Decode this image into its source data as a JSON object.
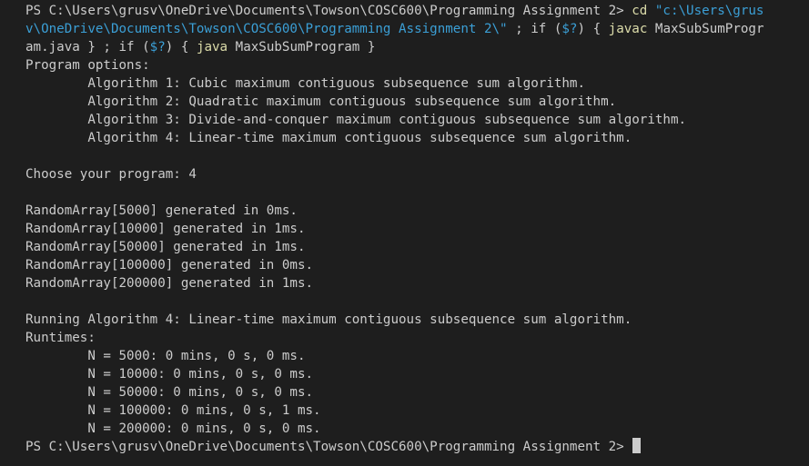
{
  "terminal": {
    "prompt": "PS C:\\Users\\grusv\\OneDrive\\Documents\\Towson\\COSC600\\Programming Assignment 2> ",
    "command": {
      "cd": "cd",
      "path_part1": "\"c:\\Users\\grus",
      "path_part2": "v\\OneDrive\\Documents\\Towson\\COSC600\\Programming Assignment 2\\\"",
      "sep1": " ; if (",
      "var1": "$?",
      "sep2": ") { ",
      "javac": "javac",
      "file_part1": " MaxSubSumProgr",
      "file_part2": "am.java",
      "sep3": " } ; if (",
      "var2": "$?",
      "sep4": ") { ",
      "java": "java",
      "class": " MaxSubSumProgram",
      "end": " }"
    },
    "output": [
      "Program options:",
      "        Algorithm 1: Cubic maximum contiguous subsequence sum algorithm.",
      "        Algorithm 2: Quadratic maximum contiguous subsequence sum algorithm.",
      "        Algorithm 3: Divide-and-conquer maximum contiguous subsequence sum algorithm.",
      "        Algorithm 4: Linear-time maximum contiguous subsequence sum algorithm.",
      "",
      "Choose your program: 4",
      "",
      "RandomArray[5000] generated in 0ms.",
      "RandomArray[10000] generated in 1ms.",
      "RandomArray[50000] generated in 1ms.",
      "RandomArray[100000] generated in 0ms.",
      "RandomArray[200000] generated in 1ms.",
      "",
      "Running Algorithm 4: Linear-time maximum contiguous subsequence sum algorithm.",
      "Runtimes:",
      "        N = 5000: 0 mins, 0 s, 0 ms.",
      "        N = 10000: 0 mins, 0 s, 0 ms.",
      "        N = 50000: 0 mins, 0 s, 0 ms.",
      "        N = 100000: 0 mins, 0 s, 1 ms.",
      "        N = 200000: 0 mins, 0 s, 0 ms."
    ],
    "final_prompt": "PS C:\\Users\\grusv\\OneDrive\\Documents\\Towson\\COSC600\\Programming Assignment 2> ",
    "colors": {
      "background": "#1e1e1e",
      "text": "#cccccc",
      "command_yellow": "#dcdcaa",
      "string_cyan": "#3b9fd6"
    }
  }
}
